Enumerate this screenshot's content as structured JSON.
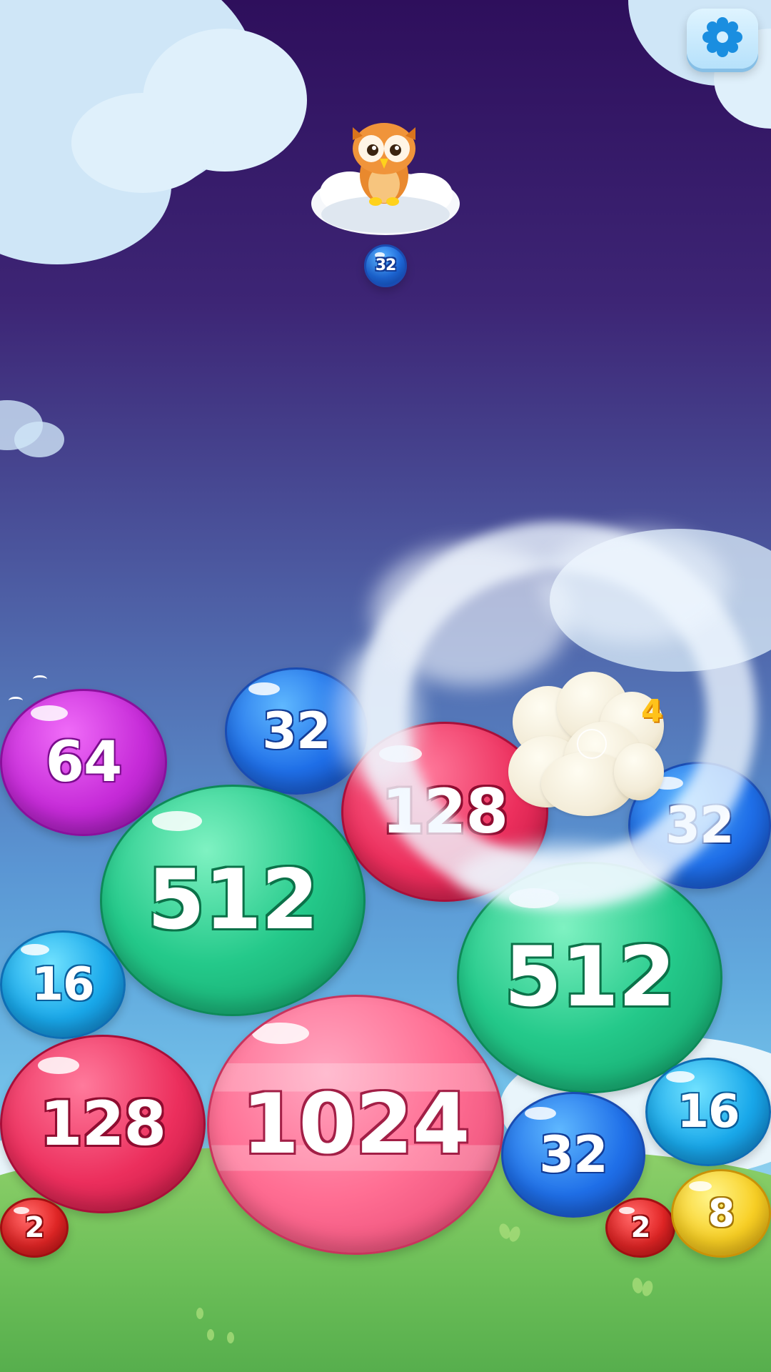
{
  "game": {
    "settings_icon": "gear-icon",
    "character": "owl-on-cloud",
    "next_bubble": {
      "value": "32",
      "color": "blue"
    },
    "combo_value": "4",
    "obstacle": "popcorn-cloud"
  },
  "bubbles": [
    {
      "value": "64",
      "color": "purple"
    },
    {
      "value": "32",
      "color": "blue"
    },
    {
      "value": "128",
      "color": "red"
    },
    {
      "value": "32",
      "color": "blue"
    },
    {
      "value": "512",
      "color": "green"
    },
    {
      "value": "512",
      "color": "green"
    },
    {
      "value": "16",
      "color": "cyan"
    },
    {
      "value": "128",
      "color": "red"
    },
    {
      "value": "1024",
      "color": "pink"
    },
    {
      "value": "16",
      "color": "cyan"
    },
    {
      "value": "32",
      "color": "blue"
    },
    {
      "value": "2",
      "color": "red"
    },
    {
      "value": "2",
      "color": "red"
    },
    {
      "value": "8",
      "color": "yellow"
    }
  ]
}
